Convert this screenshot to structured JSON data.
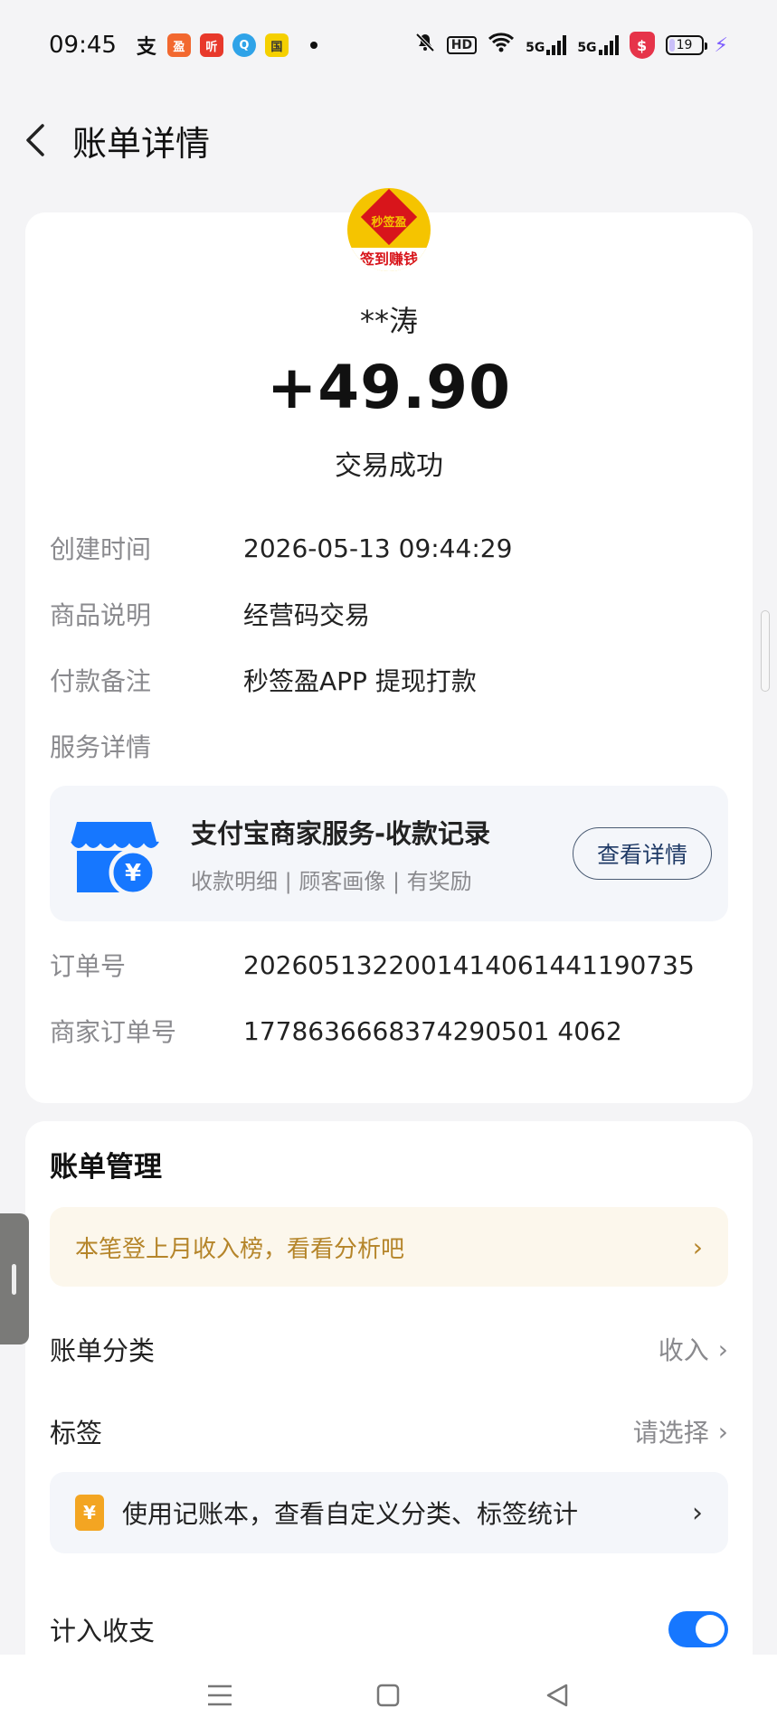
{
  "status_bar": {
    "time": "09:45",
    "app_icons": [
      "支",
      "盈",
      "听",
      "Q",
      "国"
    ],
    "hd": "HD",
    "signal_1": "5G",
    "signal_2": "5G",
    "shield": "$",
    "battery": "19",
    "battery_level_percent": 19,
    "icons": [
      "mute-bell-icon",
      "wifi-icon",
      "signal-icon",
      "charging-bolt-icon"
    ]
  },
  "header": {
    "title": "账单详情"
  },
  "payer": {
    "avatar_top_text": "秒签盈",
    "avatar_bottom_text": "签到赚钱",
    "name": "**涛",
    "amount": "+49.90",
    "status": "交易成功"
  },
  "details": {
    "created_label": "创建时间",
    "created_value": "2026-05-13 09:44:29",
    "goods_label": "商品说明",
    "goods_value": "经营码交易",
    "remark_label": "付款备注",
    "remark_value": "秒签盈APP 提现打款",
    "service_label": "服务详情",
    "order_label": "订单号",
    "order_value": "2026051322001414061441190735",
    "merchant_order_label": "商家订单号",
    "merchant_order_value": "1778636668374290501 4062"
  },
  "service": {
    "title": "支付宝商家服务-收款记录",
    "subtitle": "收款明细 | 顾客画像 | 有奖励",
    "button": "查看详情",
    "icon_glyph": "¥"
  },
  "bill_management": {
    "title": "账单管理",
    "promo": "本笔登上月收入榜，看看分析吧",
    "category_label": "账单分类",
    "category_value": "收入",
    "tag_label": "标签",
    "tag_value": "请选择",
    "ledger_icon": "¥",
    "ledger_text": "使用记账本，查看自定义分类、标签统计",
    "count_label": "计入收支",
    "count_enabled": true
  },
  "colors": {
    "accent": "#1677ff",
    "promo_text": "#b5852a",
    "ledger_icon": "#f3a522",
    "shop_icon": "#1677ff"
  }
}
